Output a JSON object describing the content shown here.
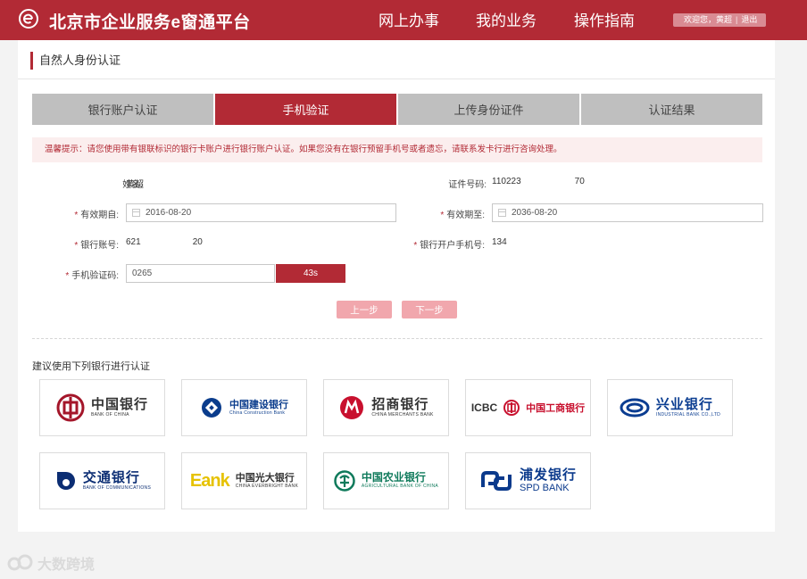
{
  "header": {
    "site_title": "北京市企业服务e窗通平台",
    "nav": [
      "网上办事",
      "我的业务",
      "操作指南"
    ],
    "welcome": "欢迎您，黄超",
    "logout": "退出"
  },
  "page": {
    "title": "自然人身份认证"
  },
  "tabs": [
    {
      "label": "银行账户认证",
      "active": false
    },
    {
      "label": "手机验证",
      "active": true
    },
    {
      "label": "上传身份证件",
      "active": false
    },
    {
      "label": "认证结果",
      "active": false
    }
  ],
  "notice": "温馨提示：请您使用带有银联标识的银行卡账户进行银行账户认证。如果您没有在银行预留手机号或者遗忘，请联系发卡行进行咨询处理。",
  "form": {
    "name_label": "姓名:",
    "name_value": "黄超",
    "id_label": "证件号码:",
    "id_value_prefix": "110223",
    "id_value_suffix": "70",
    "valid_from_label": "有效期自:",
    "valid_from_value": "2016-08-20",
    "valid_to_label": "有效期至:",
    "valid_to_value": "2036-08-20",
    "account_label": "银行账号:",
    "account_prefix": "621",
    "account_suffix": "20",
    "phone_label": "银行开户手机号:",
    "phone_prefix": "134",
    "code_label": "手机验证码:",
    "code_value": "0265",
    "countdown": "43s",
    "required_mark": "*"
  },
  "buttons": {
    "prev": "上一步",
    "next": "下一步"
  },
  "banks": {
    "heading": "建议使用下列银行进行认证",
    "items": [
      {
        "cn": "中国银行",
        "en": "BANK OF CHINA",
        "icon": "boc-icon",
        "color": "#a4162a"
      },
      {
        "cn": "中国建设银行",
        "en": "China Construction Bank",
        "icon": "ccb-icon",
        "color": "#0a3c8c"
      },
      {
        "cn": "招商银行",
        "en": "CHINA MERCHANTS BANK",
        "icon": "cmb-icon",
        "color": "#c8102e"
      },
      {
        "cn": "中国工商银行",
        "en": "ICBC",
        "icon": "icbc-icon",
        "color": "#c8102e"
      },
      {
        "cn": "兴业银行",
        "en": "INDUSTRIAL BANK CO.,LTD",
        "icon": "cib-icon",
        "color": "#0b3d91"
      },
      {
        "cn": "交通银行",
        "en": "BANK OF COMMUNICATIONS",
        "icon": "bocom-icon",
        "color": "#0b2d73"
      },
      {
        "cn": "中国光大银行",
        "en": "CHINA EVERBRIGHT BANK",
        "icon": "ceb-icon",
        "color": "#5a2d82",
        "mark": "Eank"
      },
      {
        "cn": "中国农业银行",
        "en": "AGRICULTURAL BANK OF CHINA",
        "icon": "abc-icon",
        "color": "#0f7a5b"
      },
      {
        "cn": "浦发银行",
        "en": "SPD BANK",
        "icon": "spd-icon",
        "color": "#0b3a8c"
      }
    ]
  },
  "watermark": "大数跨境",
  "colors": {
    "brand_red": "#b22a35",
    "tab_inactive": "#bfbfbf",
    "button_disabled": "#f1a7ad"
  }
}
